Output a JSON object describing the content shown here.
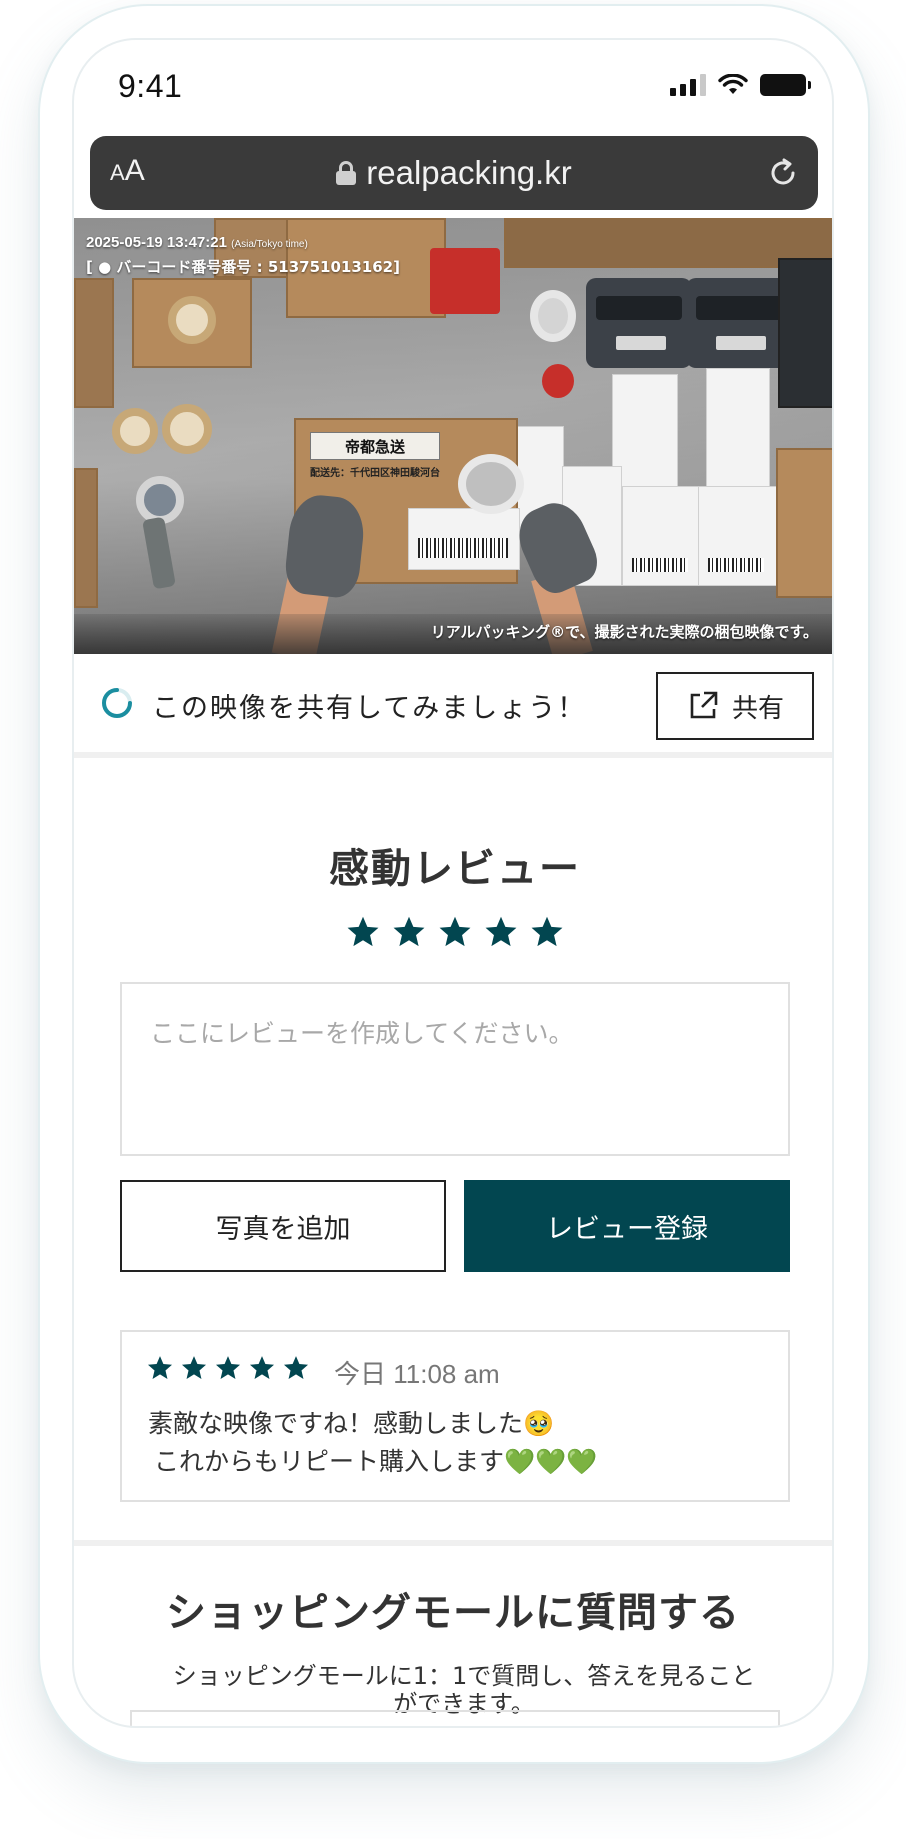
{
  "status_bar": {
    "time": "9:41"
  },
  "browser": {
    "aa_small": "A",
    "aa_large": "A",
    "url": "realpacking.kr"
  },
  "video": {
    "timestamp": "2025-05-19 13:47:21",
    "timezone": "(Asia/Tokyo time)",
    "barcode_line": "[ ● バーコード番号番号 : 513751013162]",
    "caption": "リアルパッキング®で、撮影された実際の梱包映像です。",
    "box_label": "帝都急送",
    "box_sub": "配送先：千代田区神田駿河台"
  },
  "share": {
    "prompt": "この映像を共有してみましょう！",
    "button_label": "共有"
  },
  "review_form": {
    "title": "感動レビュー",
    "rating": 5,
    "max_rating": 5,
    "placeholder": "ここにレビューを作成してください。",
    "add_photo_label": "写真を追加",
    "submit_label": "レビュー登録"
  },
  "review": {
    "rating": 5,
    "date": "今日 11:08 am",
    "line1": "素敵な映像ですね！感動しました🥹",
    "line2": "これからもリピート購入します💚💚💚"
  },
  "inquiry": {
    "title": "ショッピングモールに質問する",
    "description": "ショッピングモールに1：1で質問し、答えを見ることができます。"
  },
  "colors": {
    "accent": "#024650",
    "spinner": "#1b8ea0"
  }
}
